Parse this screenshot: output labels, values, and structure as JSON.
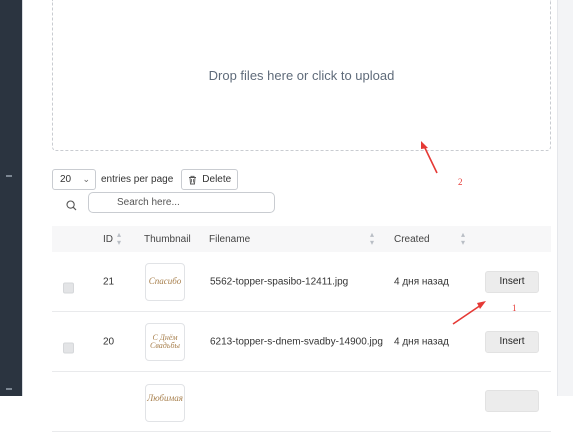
{
  "upload": {
    "dropzone_text": "Drop files here or click to upload"
  },
  "toolbar": {
    "page_size": "20",
    "entries_label": "entries per page",
    "delete_label": "Delete"
  },
  "search": {
    "placeholder": "Search here..."
  },
  "table": {
    "headers": {
      "id": "ID",
      "thumbnail": "Thumbnail",
      "filename": "Filename",
      "created": "Created"
    },
    "rows": [
      {
        "id": "21",
        "thumb_text": "Спасибо",
        "filename": "5562-topper-spasibo-12411.jpg",
        "created": "4 дня назад",
        "action": "Insert"
      },
      {
        "id": "20",
        "thumb_text": "С Днём Свадьбы",
        "filename": "6213-topper-s-dnem-svadby-14900.jpg",
        "created": "4 дня назад",
        "action": "Insert"
      },
      {
        "id": "",
        "thumb_text": "Любимая",
        "filename": "",
        "created": "",
        "action": ""
      }
    ]
  },
  "annotations": {
    "label_1": "1",
    "label_2": "2"
  },
  "colors": {
    "annotation_red": "#e53935",
    "sidebar_dark": "#2b3440",
    "button_bg": "#ececec"
  }
}
